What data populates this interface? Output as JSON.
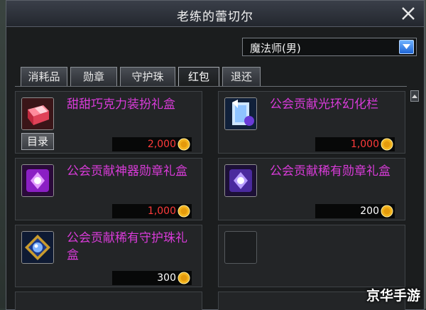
{
  "window": {
    "title": "老练的蕾切尔"
  },
  "class_select": {
    "value": "魔法师(男)"
  },
  "tabs": [
    {
      "label": "消耗品",
      "active": false
    },
    {
      "label": "勋章",
      "active": false
    },
    {
      "label": "守护珠",
      "active": false
    },
    {
      "label": "红包",
      "active": true
    },
    {
      "label": "退还",
      "active": false
    }
  ],
  "items": [
    {
      "name": "甜甜巧克力装扮礼盒",
      "price": "2,000",
      "price_color": "#ff3b3b",
      "icon": "red-gift-box-icon"
    },
    {
      "name": "公会贡献光环幻化栏",
      "price": "1,000",
      "price_color": "#ff3b3b",
      "icon": "aura-scroll-icon"
    },
    {
      "name": "公会贡献神器勋章礼盒",
      "price": "1,000",
      "price_color": "#ff3b3b",
      "icon": "purple-emblem-box-icon"
    },
    {
      "name": "公会贡献稀有勋章礼盒",
      "price": "200",
      "price_color": "#ffffff",
      "icon": "violet-emblem-box-icon"
    },
    {
      "name": "公会贡献稀有守护珠礼盒",
      "price": "300",
      "price_color": "#ffffff",
      "icon": "guardian-orb-box-icon"
    }
  ],
  "menu_button": {
    "label": "目录"
  },
  "watermark": "京华手游",
  "colors": {
    "item_name": "#d93bd9",
    "price_expensive": "#ff3b3b",
    "price_normal": "#ffffff"
  }
}
